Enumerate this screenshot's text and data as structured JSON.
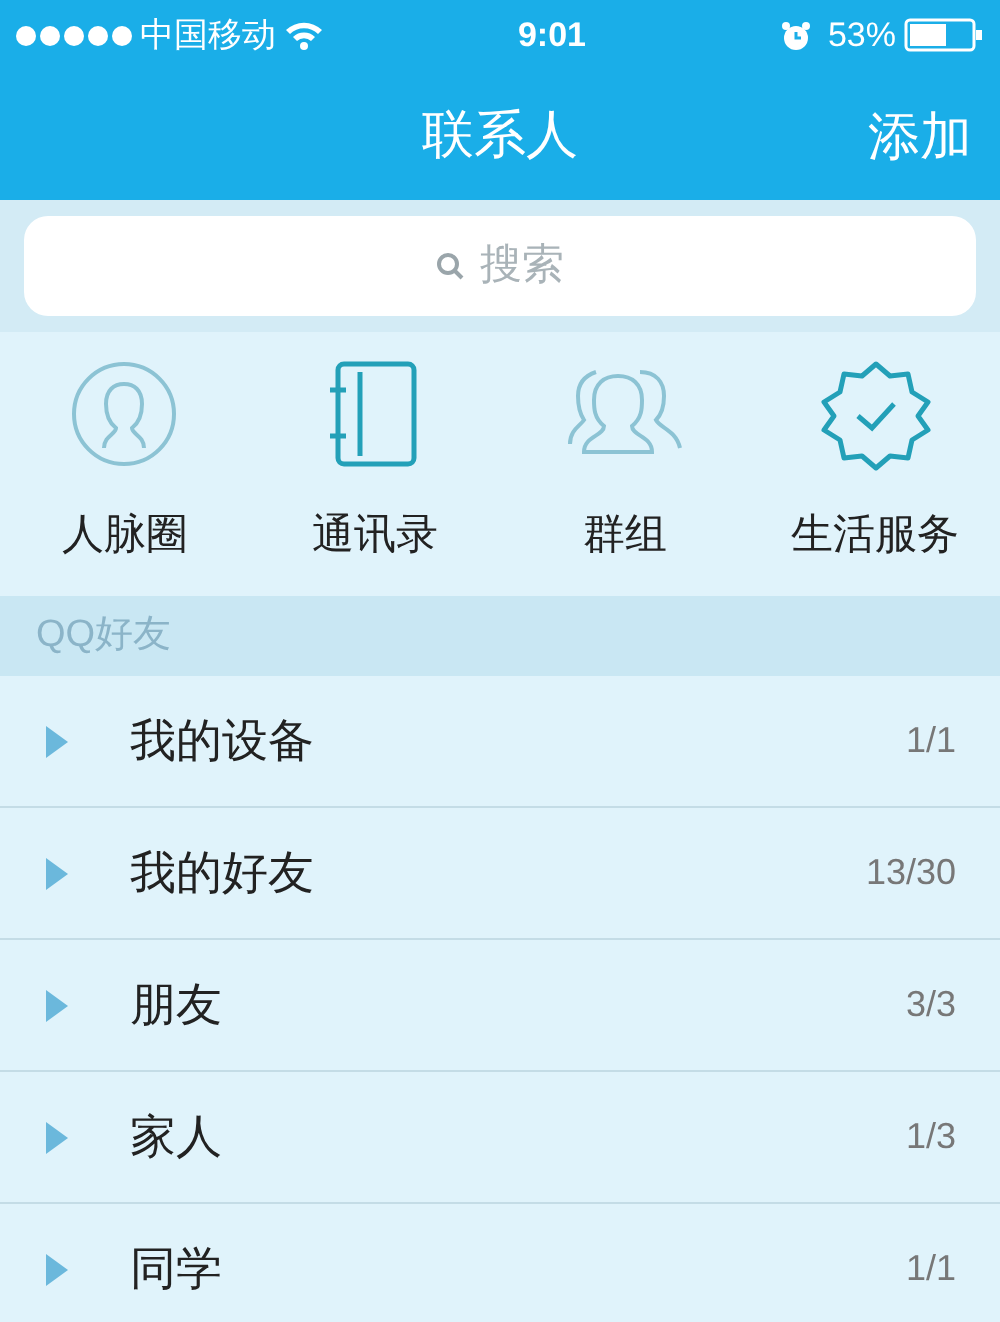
{
  "status_bar": {
    "carrier": "中国移动",
    "time": "9:01",
    "battery": "53%"
  },
  "nav": {
    "title": "联系人",
    "action": "添加"
  },
  "search": {
    "placeholder": "搜索"
  },
  "shortcuts": [
    {
      "kind": "circle",
      "label": "人脉圈"
    },
    {
      "kind": "book",
      "label": "通讯录"
    },
    {
      "kind": "group",
      "label": "群组"
    },
    {
      "kind": "badge",
      "label": "生活服务"
    }
  ],
  "section": {
    "title": "QQ好友"
  },
  "groups": [
    {
      "name": "我的设备",
      "count": "1/1",
      "expanded": false
    },
    {
      "name": "我的好友",
      "count": "13/30",
      "expanded": false
    },
    {
      "name": "朋友",
      "count": "3/3",
      "expanded": false
    },
    {
      "name": "家人",
      "count": "1/3",
      "expanded": false
    },
    {
      "name": "同学",
      "count": "1/1",
      "expanded": false
    }
  ]
}
